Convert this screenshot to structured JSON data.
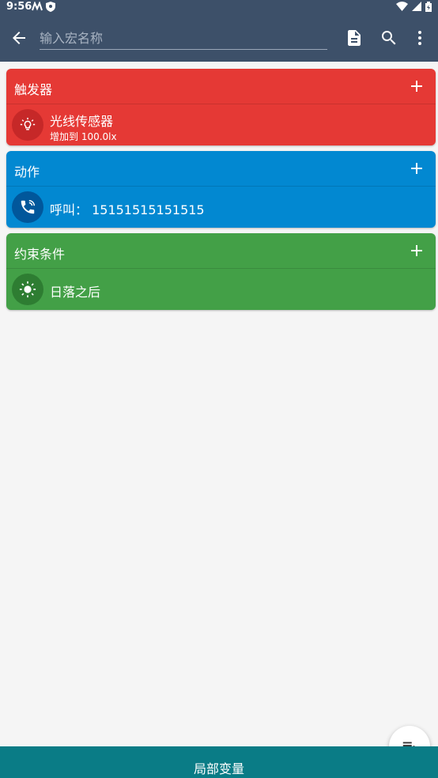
{
  "status_bar": {
    "time": "9:56"
  },
  "app_bar": {
    "name_placeholder": "输入宏名称"
  },
  "triggers": {
    "title": "触发器",
    "color": "#e53935",
    "icon_bg": "#c62828",
    "items": [
      {
        "title": "光线传感器",
        "subtitle": "增加到 100.0lx",
        "icon": "lightbulb-icon"
      }
    ]
  },
  "actions": {
    "title": "动作",
    "color": "#0288d1",
    "icon_bg": "#01579b",
    "items": [
      {
        "title": "呼叫： 15151515151515",
        "icon": "phone-call-icon"
      }
    ]
  },
  "constraints": {
    "title": "约束条件",
    "color": "#43a047",
    "icon_bg": "#2e7d32",
    "items": [
      {
        "title": "日落之后",
        "icon": "sun-icon"
      }
    ]
  },
  "bottom_bar": {
    "label": "局部变量"
  },
  "fab": {
    "icon": "playlist-add-icon"
  }
}
